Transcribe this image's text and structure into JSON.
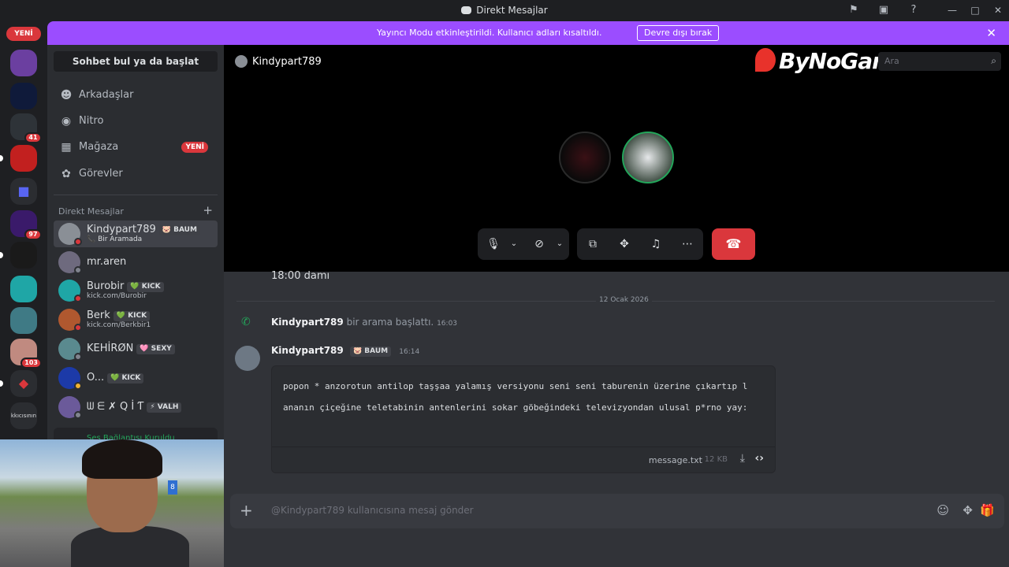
{
  "window": {
    "title": "Direkt Mesajlar"
  },
  "banner": {
    "message": "Yayıncı Modu etkinleştirildi. Kullanıcı adları kısaltıldı.",
    "button": "Devre dışı bırak"
  },
  "servers": {
    "new_label": "YENİ",
    "badges": [
      "41",
      "97",
      "103"
    ],
    "last_label": "kkıcısının"
  },
  "sidebar": {
    "search": "Sohbet bul ya da başlat",
    "nav": [
      {
        "label": "Arkadaşlar",
        "icon": "friends-icon"
      },
      {
        "label": "Nitro",
        "icon": "nitro-icon"
      },
      {
        "label": "Mağaza",
        "icon": "shop-icon",
        "badge": "YENİ"
      },
      {
        "label": "Görevler",
        "icon": "quests-icon"
      }
    ],
    "dm_header": "Direkt Mesajlar",
    "dms": [
      {
        "name": "Kindypart789",
        "tag": "🐷 BAUM",
        "sub": "📞 Bir Aramada",
        "status": "#da373c"
      },
      {
        "name": "mr.aren",
        "status": "#80848e"
      },
      {
        "name": "Burobir",
        "tag": "💚 KICK",
        "sub": "kick.com/Burobir",
        "status": "#da373c"
      },
      {
        "name": "Berk",
        "tag": "💚 KICK",
        "sub": "kick.com/Berkbir1",
        "status": "#da373c"
      },
      {
        "name": "KEHİRØN",
        "tag": "🩷 SEXY",
        "status": "#80848e"
      },
      {
        "name": "O...",
        "tag": "💚 KICK",
        "status": "#f0b232"
      },
      {
        "name": "ᗯ ᗴ ✗ Q İ Ƭ",
        "tag": "⚡ VALH",
        "status": "#80848e"
      }
    ],
    "voice_status": "Ses Bağlantısı Kuruldu"
  },
  "call": {
    "name": "Kindypart789",
    "brand": "ByNoGame",
    "search_placeholder": "Ara"
  },
  "chat": {
    "previous_message": "18:00 damı",
    "date_divider": "12 Ocak 2026",
    "system": {
      "who": "Kindypart789",
      "text": " bir arama başlattı.",
      "time": "16:03"
    },
    "message": {
      "author": "Kindypart789",
      "tag": "🐷 BAUM",
      "time": "16:14",
      "lines": [
        "popon * anzorotun antilop taşşaa yalamış versiyonu seni seni taburenin üzerine çıkartıp l",
        "ananın çiçeğine teletabinin antenlerini sokar göbeğindeki televizyondan ulusal p*rno yay:"
      ],
      "file_name": "message.txt",
      "file_size": "12 KB"
    },
    "composer_placeholder": "@Kindypart789 kullanıcısına mesaj gönder"
  }
}
